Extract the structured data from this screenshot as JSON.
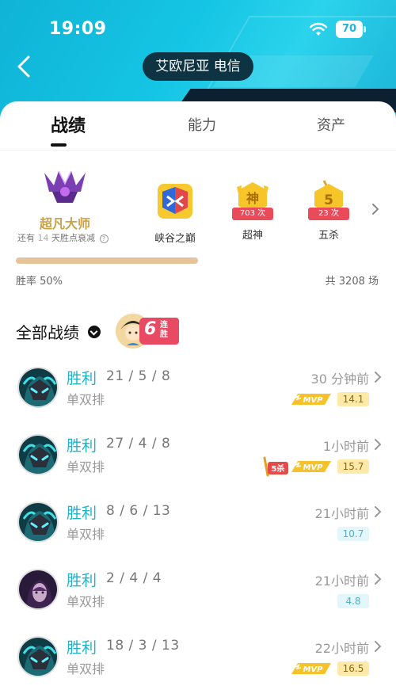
{
  "status": {
    "time": "19:09",
    "battery": "70"
  },
  "header": {
    "server": "艾欧尼亚 电信"
  },
  "tabs": [
    {
      "label": "战绩"
    },
    {
      "label": "能力"
    },
    {
      "label": "资产"
    }
  ],
  "rank": {
    "name": "超凡大师",
    "note_prefix": "还有",
    "note_num": "14",
    "note_suffix": "天胜点衰减"
  },
  "badges": [
    {
      "label": "峡谷之巅",
      "count": ""
    },
    {
      "label": "超神",
      "count": "703 次",
      "glyph": "神"
    },
    {
      "label": "五杀",
      "count": "23 次",
      "glyph": "5"
    }
  ],
  "stats": {
    "winrate": "胜率 50%",
    "winrate_value": 0.5,
    "total": "共 3208 场"
  },
  "records": {
    "title": "全部战绩",
    "streak_num": "6",
    "streak_text": "连胜"
  },
  "matches": [
    {
      "result": "胜利",
      "kda": "21 / 5 / 8",
      "mode": "单双排",
      "time": "30 分钟前",
      "score": "14.1",
      "mvp": true,
      "penta": false,
      "hero": "teal"
    },
    {
      "result": "胜利",
      "kda": "27 / 4 / 8",
      "mode": "单双排",
      "time": "1小时前",
      "score": "15.7",
      "mvp": true,
      "penta": true,
      "hero": "teal"
    },
    {
      "result": "胜利",
      "kda": "8 / 6 / 13",
      "mode": "单双排",
      "time": "21小时前",
      "score": "10.7",
      "mvp": false,
      "penta": false,
      "hero": "teal"
    },
    {
      "result": "胜利",
      "kda": "2 / 4 / 4",
      "mode": "单双排",
      "time": "21小时前",
      "score": "4.8",
      "mvp": false,
      "penta": false,
      "hero": "purple"
    },
    {
      "result": "胜利",
      "kda": "18 / 3 / 13",
      "mode": "单双排",
      "time": "22小时前",
      "score": "16.5",
      "mvp": true,
      "penta": false,
      "hero": "teal"
    }
  ],
  "labels": {
    "mvp": "MVP",
    "penta": "5杀"
  },
  "colors": {
    "accent": "#24b0c6",
    "header": "#15c5e4",
    "win": "#24b0c6",
    "rank_gold": "#c9a14a"
  }
}
